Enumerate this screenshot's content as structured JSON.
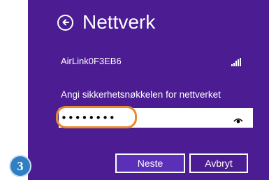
{
  "header": {
    "title": "Nettverk",
    "back_icon": "back-arrow-circle-icon"
  },
  "network": {
    "name": "AirLink0F3EB6",
    "signal_icon": "signal-strength-icon"
  },
  "password": {
    "prompt": "Angi sikkerhetsnøkkelen for nettverket",
    "masked_value": "••••••••",
    "reveal_icon": "eye-icon"
  },
  "buttons": {
    "next_label": "Neste",
    "cancel_label": "Avbryt"
  },
  "step_badge": {
    "number": "3"
  },
  "colors": {
    "panel_background": "#4b1c92",
    "primary_button": "#5b2fb8",
    "highlight": "#e8892f",
    "badge": "#2f7fc2"
  }
}
